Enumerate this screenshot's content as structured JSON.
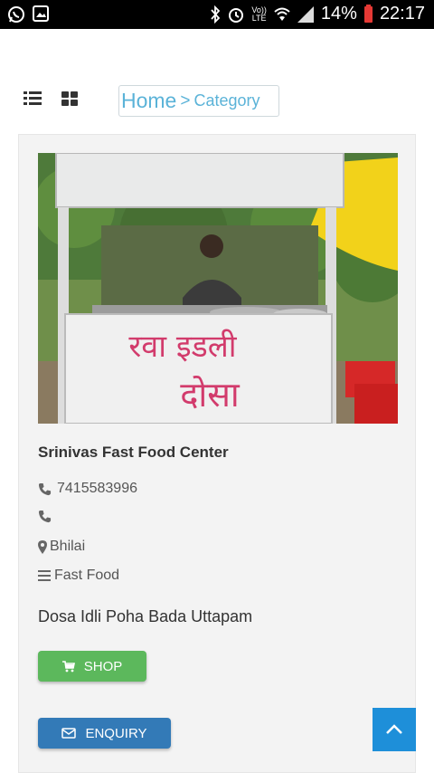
{
  "status_bar": {
    "battery_percent": "14%",
    "time": "22:17",
    "volte_top": "Vo))",
    "volte_bottom": "LTE",
    "icons": [
      "whatsapp-icon",
      "gallery-icon",
      "bluetooth-icon",
      "alarm-icon",
      "volte-icon",
      "wifi-icon",
      "signal-icon",
      "battery-icon"
    ]
  },
  "view_toggle": {
    "icons": [
      "list-view-icon",
      "grid-view-icon"
    ]
  },
  "breadcrumb": {
    "home": "Home",
    "separator": ">",
    "current": "Category"
  },
  "listing": {
    "name": "Srinivas Fast Food Center",
    "phone_1": "7415583996",
    "phone_2": "",
    "location": "Bhilai",
    "category": "Fast Food",
    "description": "Dosa Idli Poha Bada Uttapam",
    "shop_label": "SHOP",
    "enquiry_label": "ENQUIRY",
    "photo_text_top": "रवा इडली",
    "photo_text_bottom": "दोसा"
  },
  "colors": {
    "accent_blue": "#5bb3d8",
    "shop_green": "#5cb85c",
    "enquiry_blue": "#337ab7",
    "to_top_blue": "#1e8fd9"
  }
}
